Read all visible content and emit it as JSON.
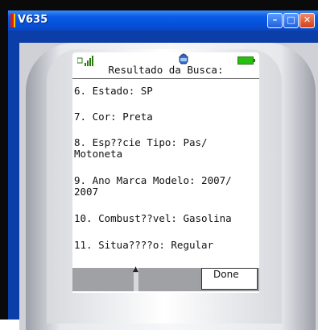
{
  "window": {
    "title": "V635",
    "minimize_glyph": "–",
    "maximize_glyph": "□",
    "close_glyph": "✕"
  },
  "screen": {
    "title": "Resultado da Busca:",
    "items": [
      {
        "text": "6. Estado: SP"
      },
      {
        "text": "7. Cor: Preta"
      },
      {
        "text": "8. Esp??cie Tipo: Pas/\nMotoneta"
      },
      {
        "text": "9. Ano Marca Modelo: 2007/\n2007"
      },
      {
        "text": "10. Combust??vel: Gasolina"
      },
      {
        "text": "11. Situa????o: Regular"
      }
    ]
  },
  "softkeys": {
    "scroll_glyph": "▲",
    "done_label": "Done"
  },
  "colors": {
    "title_bar": "#0a5ce8",
    "battery": "#26c010"
  }
}
